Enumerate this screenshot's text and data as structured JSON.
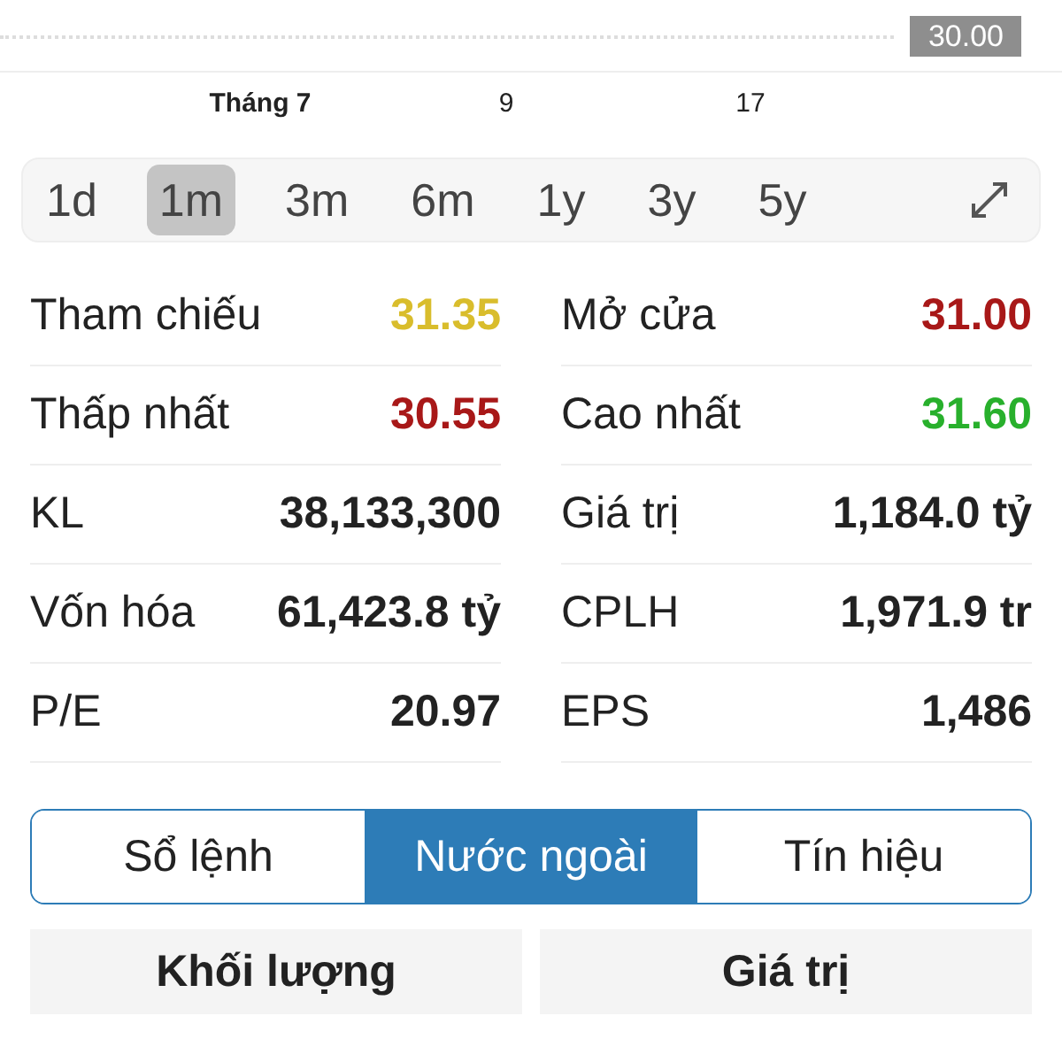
{
  "chart": {
    "price_badge": "30.00",
    "x_labels": [
      {
        "label": "Tháng 7",
        "bold": true
      },
      {
        "label": "9",
        "bold": false
      },
      {
        "label": "17",
        "bold": false
      }
    ]
  },
  "periods": [
    {
      "label": "1d",
      "selected": false
    },
    {
      "label": "1m",
      "selected": true
    },
    {
      "label": "3m",
      "selected": false
    },
    {
      "label": "6m",
      "selected": false
    },
    {
      "label": "1y",
      "selected": false
    },
    {
      "label": "3y",
      "selected": false
    },
    {
      "label": "5y",
      "selected": false
    }
  ],
  "stats": [
    [
      {
        "label": "Tham chiếu",
        "value": "31.35",
        "color": "#d9bd2c"
      },
      {
        "label": "Mở cửa",
        "value": "31.00",
        "color": "#a81818"
      }
    ],
    [
      {
        "label": "Thấp nhất",
        "value": "30.55",
        "color": "#a81818"
      },
      {
        "label": "Cao nhất",
        "value": "31.60",
        "color": "#28b02c"
      }
    ],
    [
      {
        "label": "KL",
        "value": "38,133,300",
        "color": "#222222"
      },
      {
        "label": "Giá trị",
        "value": "1,184.0 tỷ",
        "color": "#222222"
      }
    ],
    [
      {
        "label": "Vốn hóa",
        "value": "61,423.8 tỷ",
        "color": "#222222"
      },
      {
        "label": "CPLH",
        "value": "1,971.9 tr",
        "color": "#222222"
      }
    ],
    [
      {
        "label": "P/E",
        "value": "20.97",
        "color": "#222222"
      },
      {
        "label": "EPS",
        "value": "1,486",
        "color": "#222222"
      }
    ]
  ],
  "tabs": [
    {
      "label": "Sổ lệnh",
      "selected": false
    },
    {
      "label": "Nước ngoài",
      "selected": true
    },
    {
      "label": "Tín hiệu",
      "selected": false
    }
  ],
  "table_headers": [
    "Khối lượng",
    "Giá trị"
  ]
}
